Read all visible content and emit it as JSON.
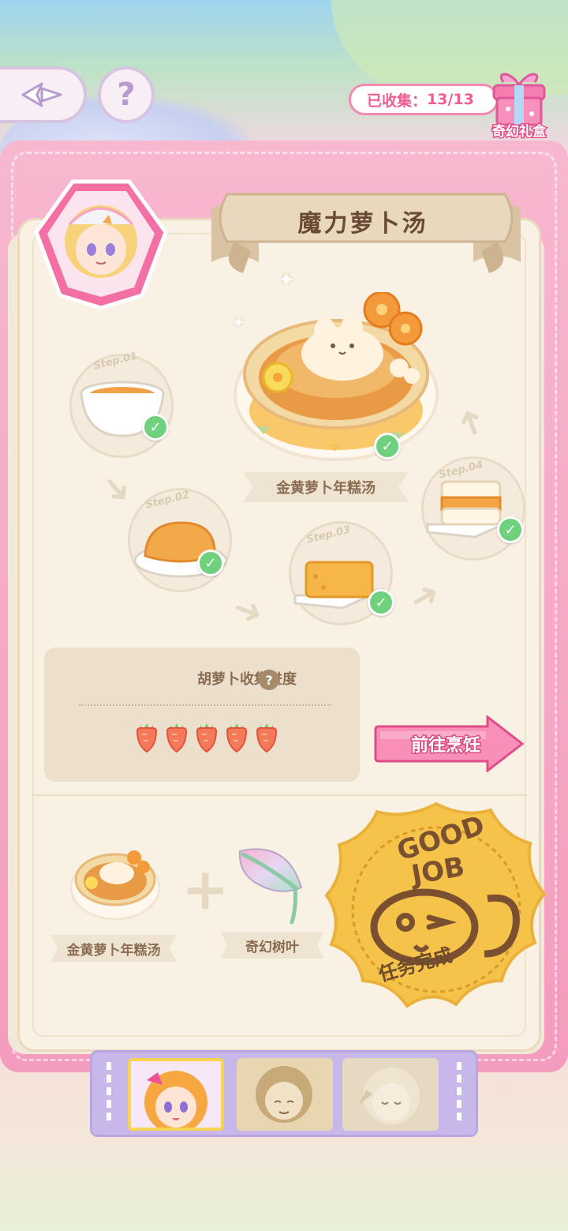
{
  "header": {
    "collected_label": "已收集：",
    "collected_value": "13/13",
    "gift_label": "奇幻礼盒"
  },
  "recipe": {
    "title": "魔力萝卜汤",
    "main_dish_name": "金黄萝卜年糕汤",
    "steps": [
      {
        "tag": "Step.01"
      },
      {
        "tag": "Step.02"
      },
      {
        "tag": "Step.03"
      },
      {
        "tag": "Step.04"
      }
    ]
  },
  "progress": {
    "title": "胡萝卜收集进度",
    "help": "?",
    "carrots_collected": 5,
    "carrots_total": 5
  },
  "actions": {
    "go_cook_label": "前往烹饪"
  },
  "ingredients": {
    "item1_label": "金黄萝卜年糕汤",
    "plus": "+",
    "item2_label": "奇幻树叶"
  },
  "stamp": {
    "top_text": "GOOD JOB",
    "bottom_text": "任务完成"
  },
  "icons": {
    "back": "winged-arrow-icon",
    "help": "question-icon",
    "gift": "gift-box-icon",
    "check": "check-icon"
  },
  "colors": {
    "accent_pink": "#ee5d94",
    "check_green": "#6fd07d",
    "stamp_gold": "#f5c24a",
    "panel_beige": "#f8f1e4"
  }
}
